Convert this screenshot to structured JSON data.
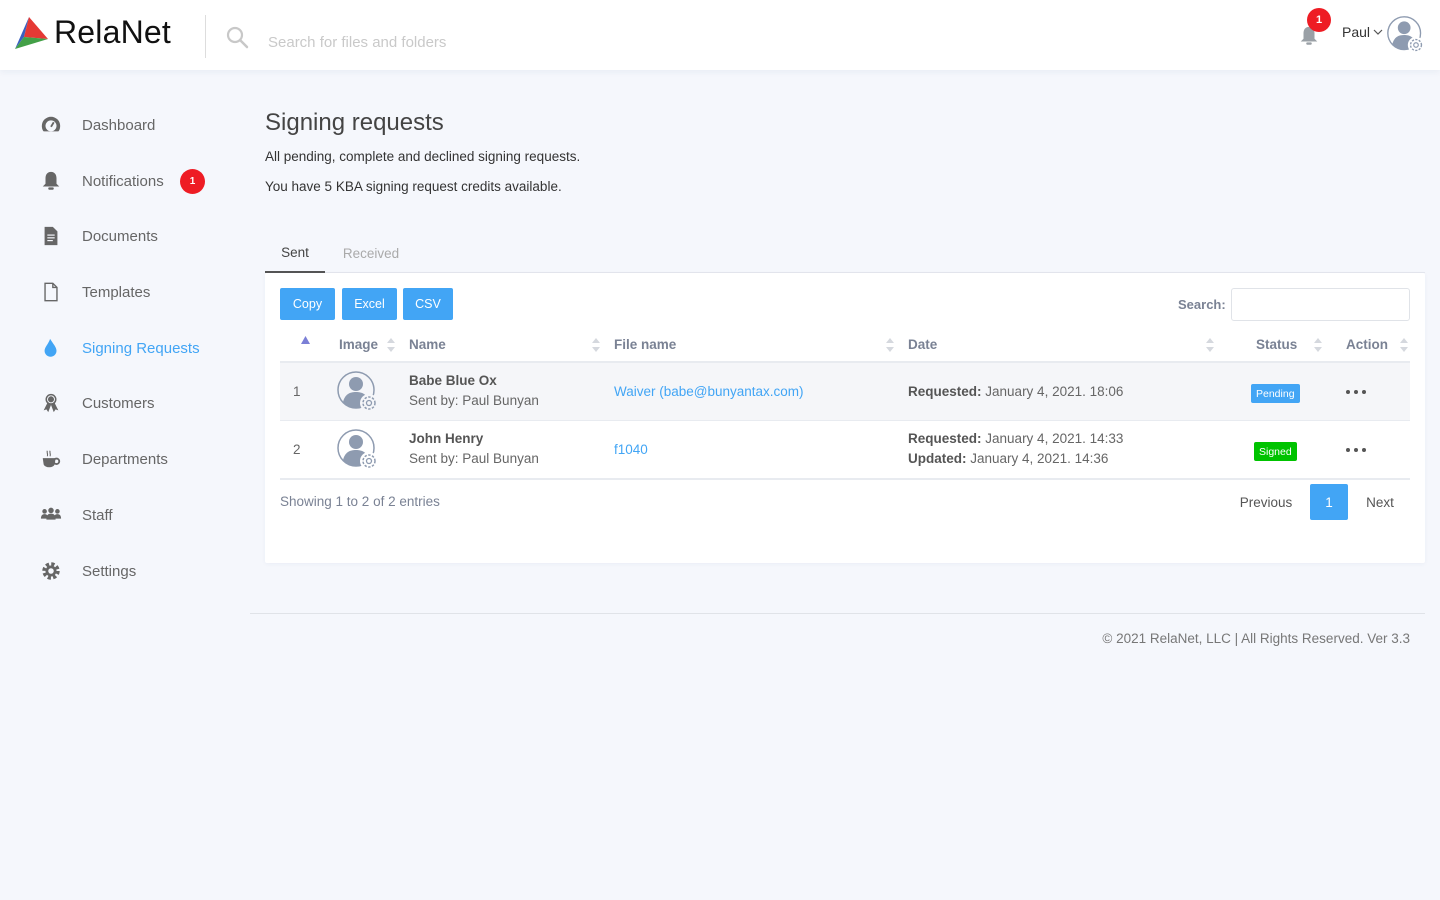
{
  "header": {
    "app_name": "RelaNet",
    "search_placeholder": "Search for files and folders",
    "notification_count": "1",
    "user_name": "Paul"
  },
  "sidebar": {
    "items": [
      {
        "label": "Dashboard",
        "icon": "dashboard-gauge-icon",
        "active": false
      },
      {
        "label": "Notifications",
        "icon": "bell-icon",
        "active": false,
        "badge": "1"
      },
      {
        "label": "Documents",
        "icon": "document-icon",
        "active": false
      },
      {
        "label": "Templates",
        "icon": "blank-file-icon",
        "active": false
      },
      {
        "label": "Signing Requests",
        "icon": "drop-icon",
        "active": true
      },
      {
        "label": "Customers",
        "icon": "award-ribbon-icon",
        "active": false
      },
      {
        "label": "Departments",
        "icon": "coffee-cup-icon",
        "active": false
      },
      {
        "label": "Staff",
        "icon": "users-group-icon",
        "active": false
      },
      {
        "label": "Settings",
        "icon": "gear-icon",
        "active": false
      }
    ]
  },
  "main": {
    "title": "Signing requests",
    "subtitle": "All pending, complete and declined signing requests.",
    "credits_text": "You have 5 KBA signing request credits available.",
    "tabs": [
      {
        "label": "Sent",
        "active": true
      },
      {
        "label": "Received",
        "active": false
      }
    ],
    "toolbar": {
      "copy_label": "Copy",
      "excel_label": "Excel",
      "csv_label": "CSV",
      "search_label": "Search:",
      "search_value": ""
    },
    "table": {
      "columns": [
        "",
        "Image",
        "Name",
        "File name",
        "Date",
        "Status",
        "Action"
      ],
      "rows": [
        {
          "num": "1",
          "name": "Babe Blue Ox",
          "sender": "Sent by: Paul Bunyan",
          "file": "Waiver (babe@bunyantax.com)",
          "requested_label": "Requested:",
          "requested": "January 4, 2021. 18:06",
          "status": "Pending",
          "status_color": "#42a5f5"
        },
        {
          "num": "2",
          "name": "John Henry",
          "sender": "Sent by: Paul Bunyan",
          "file": "f1040",
          "requested_label": "Requested:",
          "requested": "January 4, 2021. 14:33",
          "updated_label": "Updated:",
          "updated": "January 4, 2021. 14:36",
          "status": "Signed",
          "status_color": "#00c300"
        }
      ]
    },
    "info": "Showing 1 to 2 of 2 entries",
    "pagination": {
      "previous": "Previous",
      "current": "1",
      "next": "Next"
    }
  },
  "footer": {
    "text": "© 2021 RelaNet, LLC | All Rights Reserved. Ver 3.3"
  },
  "colors": {
    "accent": "#42a5f5",
    "badge_red": "#ee1c24",
    "signed_green": "#00c300"
  }
}
